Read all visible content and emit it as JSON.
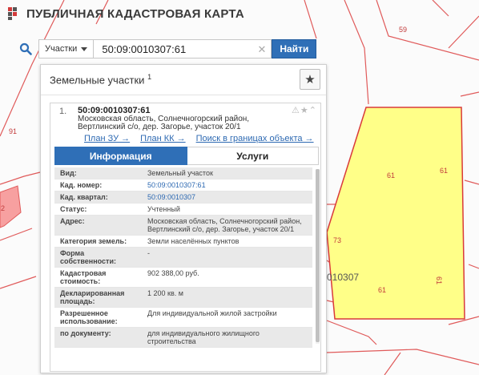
{
  "app": {
    "title": "ПУБЛИЧНАЯ КАДАСТРОВАЯ КАРТА"
  },
  "search": {
    "type_label": "Участки",
    "query": "50:09:0010307:61",
    "find_label": "Найти"
  },
  "map": {
    "labels": [
      "59",
      "91",
      "61",
      "61",
      "61",
      "61",
      "73",
      "010307",
      "2"
    ],
    "parcel_color": "#ffff88",
    "boundary_color": "#d93a3a"
  },
  "panel": {
    "title": "Земельные участки",
    "title_count": "1"
  },
  "result": {
    "index": "1.",
    "number": "50:09:0010307:61",
    "address": "Московская область, Солнечногорский район, Вертлинский с/о, дер. Загорье, участок 20/1",
    "links": [
      "План ЗУ →",
      "План КК →",
      "Поиск в границах объекта →"
    ]
  },
  "tabs": [
    "Информация",
    "Услуги"
  ],
  "info": [
    {
      "label": "Вид:",
      "value": "Земельный участок",
      "link": false
    },
    {
      "label": "Кад. номер:",
      "value": "50:09:0010307:61",
      "link": true
    },
    {
      "label": "Кад. квартал:",
      "value": "50:09:0010307",
      "link": true
    },
    {
      "label": "Статус:",
      "value": "Учтенный",
      "link": false
    },
    {
      "label": "Адрес:",
      "value": "Московская область, Солнечногорский район, Вертлинский с/о, дер. Загорье, участок 20/1",
      "link": false
    },
    {
      "label": "Категория земель:",
      "value": "Земли населённых пунктов",
      "link": false
    },
    {
      "label": "Форма собственности:",
      "value": "-",
      "link": false
    },
    {
      "label": "Кадастровая стоимость:",
      "value": "902 388,00 руб.",
      "link": false
    },
    {
      "label": "Декларированная площадь:",
      "value": "1 200 кв. м",
      "link": false
    },
    {
      "label": "Разрешенное использование:",
      "value": "Для индивидуальной жилой застройки",
      "link": false
    },
    {
      "label": "по документу:",
      "value": "для индивидуального жилищного строительства",
      "link": false
    }
  ]
}
